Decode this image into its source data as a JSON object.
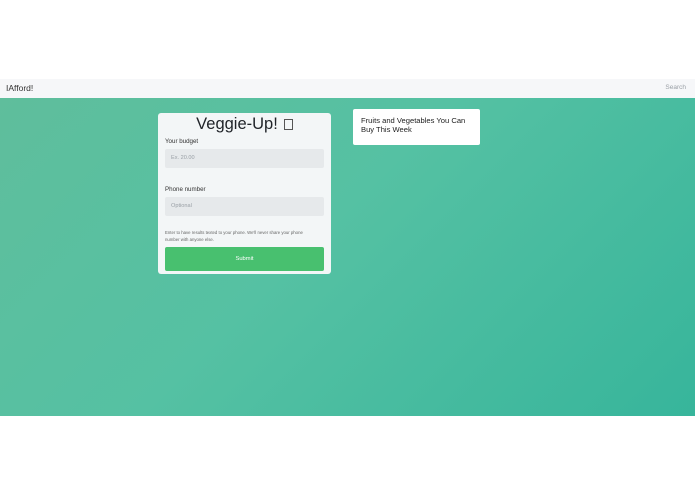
{
  "navbar": {
    "brand": "IAfford!",
    "search": "Search"
  },
  "form": {
    "title": "Veggie-Up!",
    "budget_label": "Your budget",
    "budget_placeholder": "Ex. 20.00",
    "phone_label": "Phone number",
    "phone_placeholder": "Optional",
    "help_text": "Enter to have results texted to your phone. We'll never share your phone number with anyone else.",
    "submit_label": "Submit"
  },
  "results": {
    "title": "Fruits and Vegetables You Can Buy This Week"
  }
}
